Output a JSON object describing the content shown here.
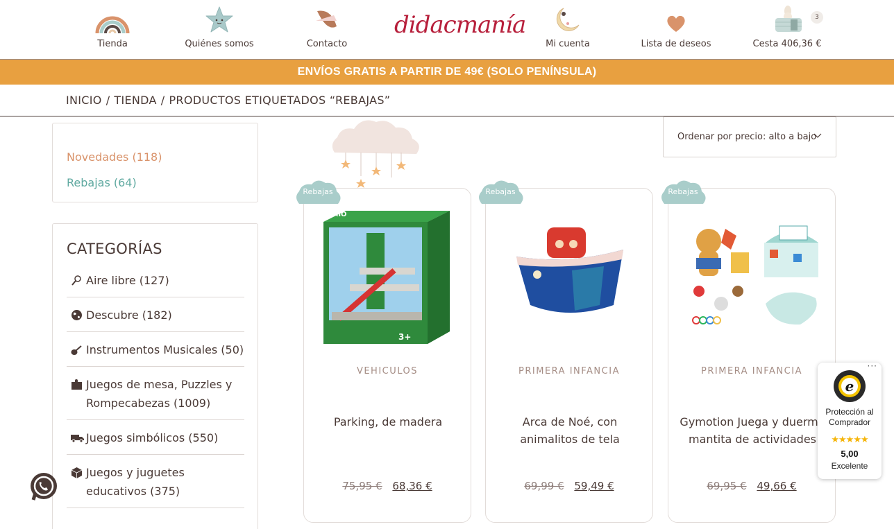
{
  "nav": {
    "shop": "Tienda",
    "about": "Quiénes somos",
    "contact": "Contacto",
    "logo": "didacmanía",
    "account": "Mi cuenta",
    "wishlist": "Lista de deseos",
    "cart": "Cesta 406,36 €",
    "cart_count": "3"
  },
  "banner": "ENVÍOS GRATIS A PARTIR DE 49€ (SOLO PENÍNSULA)",
  "breadcrumb": {
    "home": "INICIO",
    "shop": "TIENDA",
    "current": "PRODUCTOS ETIQUETADOS “REBAJAS”",
    "sep": "/"
  },
  "filters": {
    "new": "Novedades (118)",
    "sale": "Rebajas (64)"
  },
  "categories": {
    "title": "CATEGORÍAS",
    "items": [
      {
        "label": "Aire libre (127)",
        "icon": "racket-icon"
      },
      {
        "label": "Descubre (182)",
        "icon": "globe-icon"
      },
      {
        "label": "Instrumentos Musicales (50)",
        "icon": "guitar-icon"
      },
      {
        "label": "Juegos de mesa, Puzzles y Rompecabezas (1009)",
        "icon": "puzzle-icon"
      },
      {
        "label": "Juegos simbólicos (550)",
        "icon": "truck-icon"
      },
      {
        "label": "Juegos y juguetes educativos (375)",
        "icon": "box-icon"
      }
    ]
  },
  "sort": {
    "label": "Ordenar por precio: alto a bajo"
  },
  "products": [
    {
      "badge": "Rebajas",
      "category": "VEHICULOS",
      "name": "Parking, de madera",
      "old_price": "75,95 €",
      "price": "68,36 €"
    },
    {
      "badge": "Rebajas",
      "category": "PRIMERA INFANCIA",
      "name": "Arca de Noé, con animalitos de tela",
      "old_price": "69,99 €",
      "price": "59,49 €"
    },
    {
      "badge": "Rebajas",
      "category": "PRIMERA INFANCIA",
      "name": "Gymotion Juega y duerme mantita de actividades",
      "old_price": "69,95 €",
      "price": "49,66 €"
    }
  ],
  "trusted_shops": {
    "title": "Protección al Comprador",
    "stars": "★★★★★",
    "score": "5,00",
    "label": "Excelente",
    "more": "···"
  },
  "colors": {
    "banner": "#e8a040",
    "text": "#4a3a36",
    "new_link": "#d9936b",
    "sale_link": "#5fa9a0",
    "badge_cloud": "#a9cdca",
    "logo": "#b71f3b"
  }
}
